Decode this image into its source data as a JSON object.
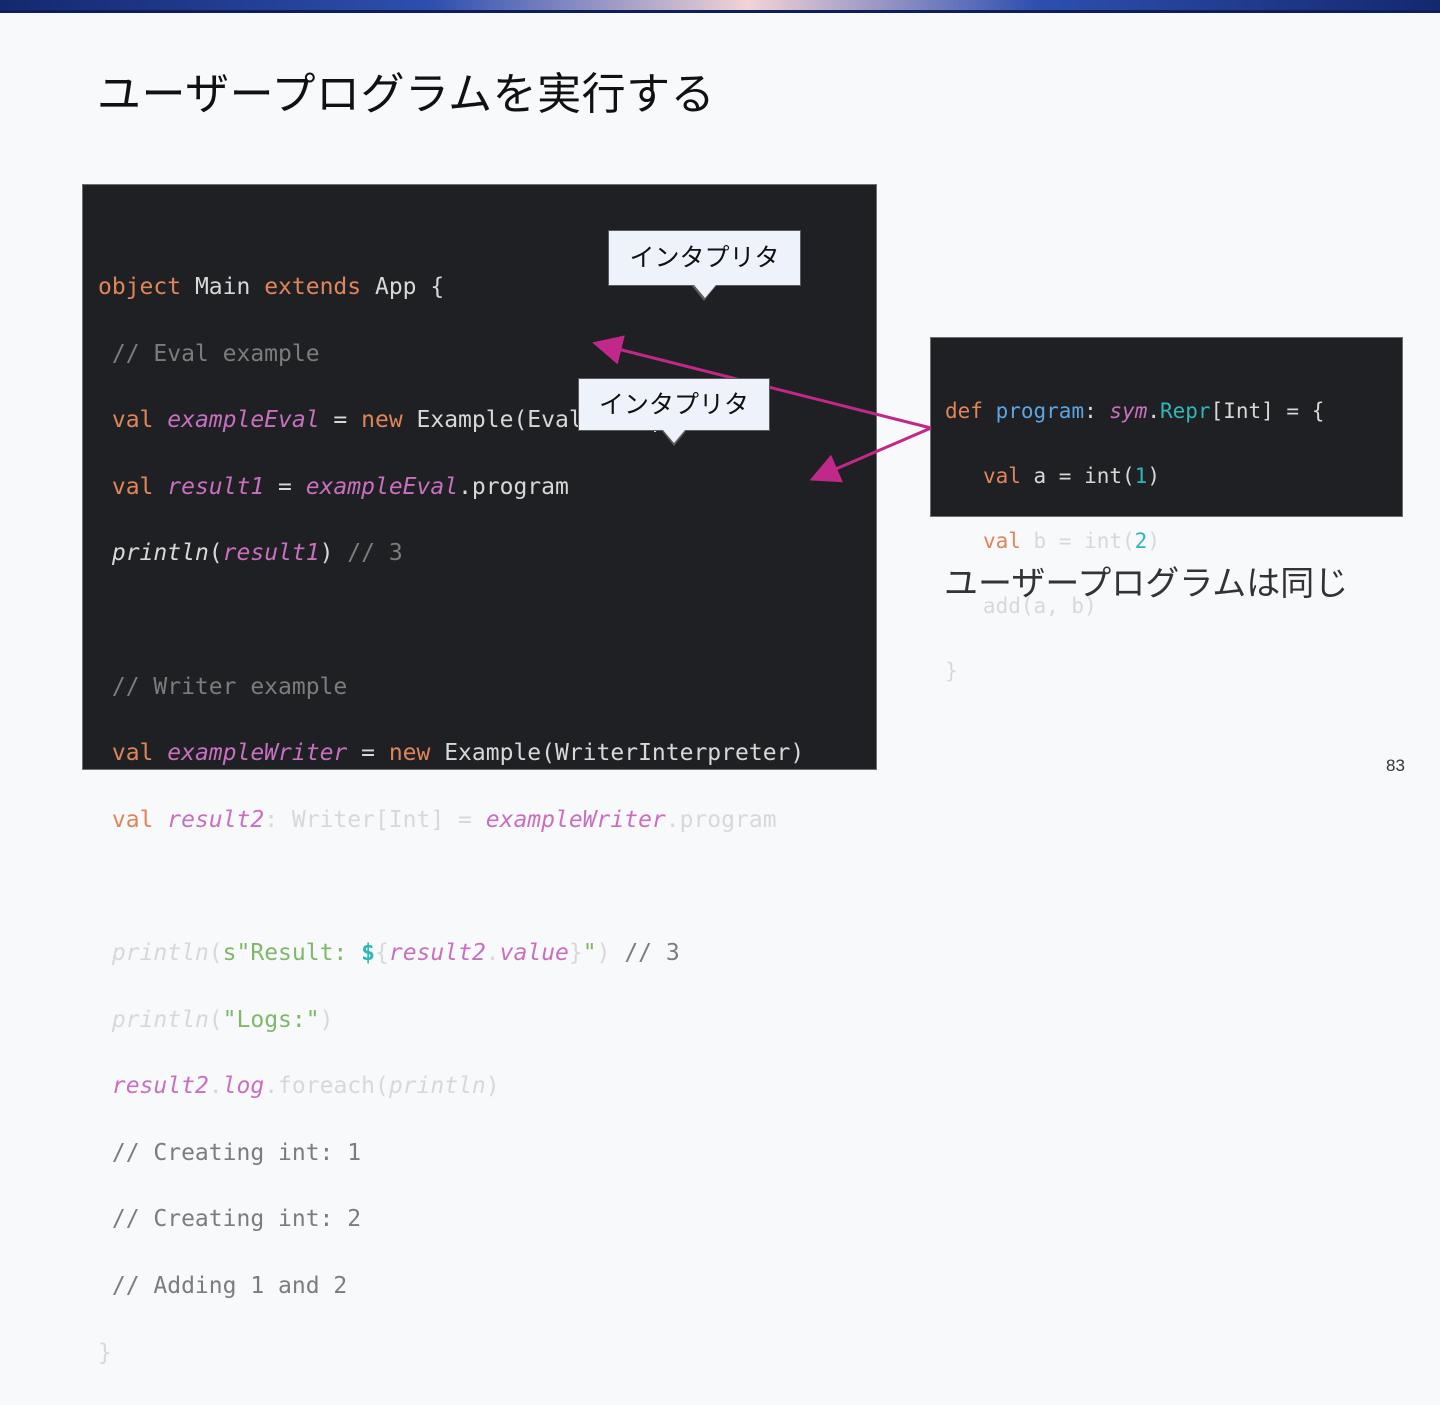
{
  "slide": {
    "title": "ユーザープログラムを実行する",
    "caption": "ユーザープログラムは同じ",
    "page_number": "83"
  },
  "callouts": {
    "first": "インタプリタ",
    "second": "インタプリタ"
  },
  "colors": {
    "arrow": "#c0288a",
    "code_background": "#1f2023",
    "keyword": "#e0855a",
    "italic_identifier": "#c96fc0",
    "comment": "#7c7c7c",
    "string": "#7fb86a",
    "number": "#2fb7b7"
  },
  "main_code": {
    "l1": {
      "kw1": "object",
      "t1": " Main ",
      "kw2": "extends",
      "t2": " App {"
    },
    "l2": {
      "comment": " // Eval example"
    },
    "l3": {
      "kw": " val",
      "sp": " ",
      "id": "exampleEval",
      "t1": " = ",
      "kw2": "new",
      "t2": " Example(EvalInterpreter)"
    },
    "l4": {
      "kw": " val",
      "sp": " ",
      "id": "result1",
      "t1": " = ",
      "id2": "exampleEval",
      "t2": ".program"
    },
    "l5": {
      "sp": " ",
      "fn": "println",
      "t1": "(",
      "id": "result1",
      "t2": ") ",
      "comment": "// 3"
    },
    "l6": {
      "text": ""
    },
    "l7": {
      "comment": " // Writer example"
    },
    "l8": {
      "kw": " val",
      "sp": " ",
      "id": "exampleWriter",
      "t1": " = ",
      "kw2": "new",
      "t2": " Example(WriterInterpreter)"
    },
    "l9": {
      "kw": " val",
      "sp": " ",
      "id": "result2",
      "t1": ": Writer[Int] = ",
      "id2": "exampleWriter",
      "t2": ".program"
    },
    "l10": {
      "text": ""
    },
    "l11": {
      "sp": " ",
      "fn": "println",
      "t1": "(",
      "str1": "s\"Result: ",
      "interp": "$",
      "t2": "{",
      "id": "result2",
      "t3": ".",
      "id2": "value",
      "t4": "}",
      "str2": "\"",
      "t5": ") ",
      "comment": "// 3"
    },
    "l12": {
      "sp": " ",
      "fn": "println",
      "t1": "(",
      "str": "\"Logs:\"",
      "t2": ")"
    },
    "l13": {
      "sp": " ",
      "id": "result2",
      "t1": ".",
      "id2": "log",
      "t2": ".foreach(",
      "fn": "println",
      "t3": ")"
    },
    "l14": {
      "comment": " // Creating int: 1"
    },
    "l15": {
      "comment": " // Creating int: 2"
    },
    "l16": {
      "comment": " // Adding 1 and 2"
    },
    "l17": {
      "text": "}"
    }
  },
  "side_code": {
    "l1": {
      "kw": "def",
      "sp": " ",
      "fn": "program",
      "t1": ": ",
      "id": "sym",
      "t2": ".",
      "typ": "Repr",
      "t3": "[Int] = {"
    },
    "l2": {
      "ind": "   ",
      "kw": "val",
      "t1": " a = int(",
      "num": "1",
      "t2": ")"
    },
    "l3": {
      "ind": "   ",
      "kw": "val",
      "t1": " b = int(",
      "num": "2",
      "t2": ")"
    },
    "l4": {
      "text": "   add(a, b)"
    },
    "l5": {
      "text": "}"
    }
  }
}
